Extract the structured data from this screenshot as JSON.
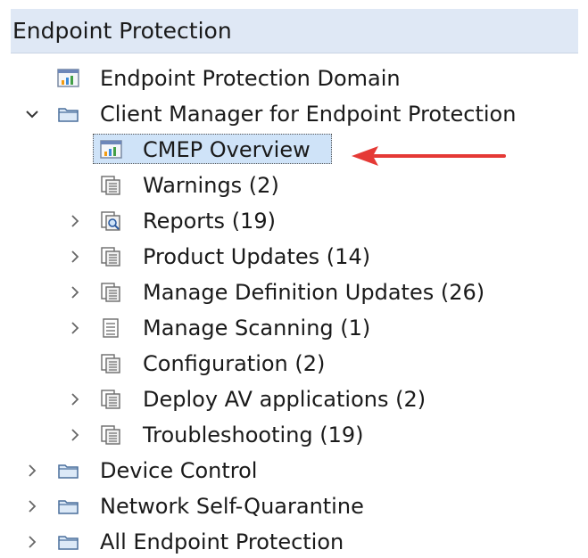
{
  "header": {
    "title": "Endpoint Protection"
  },
  "tree": {
    "items": [
      {
        "label": "Endpoint Protection Domain",
        "icon": "dashboard-icon",
        "expanded": null
      },
      {
        "label": "Client Manager for Endpoint Protection",
        "icon": "folder-icon",
        "expanded": true
      },
      {
        "label": "CMEP Overview",
        "icon": "dashboard-icon",
        "selected": true
      },
      {
        "label": "Warnings (2)",
        "icon": "report-list-icon"
      },
      {
        "label": "Reports (19)",
        "icon": "report-search-icon",
        "expanded": false
      },
      {
        "label": "Product Updates (14)",
        "icon": "report-list-icon",
        "expanded": false
      },
      {
        "label": "Manage Definition Updates (26)",
        "icon": "report-list-icon",
        "expanded": false
      },
      {
        "label": "Manage Scanning (1)",
        "icon": "list-icon",
        "expanded": false
      },
      {
        "label": "Configuration (2)",
        "icon": "report-list-icon"
      },
      {
        "label": "Deploy AV applications (2)",
        "icon": "report-list-icon",
        "expanded": false
      },
      {
        "label": "Troubleshooting (19)",
        "icon": "report-list-icon",
        "expanded": false
      },
      {
        "label": "Device Control",
        "icon": "folder-icon",
        "expanded": false
      },
      {
        "label": "Network Self-Quarantine",
        "icon": "folder-icon",
        "expanded": false
      },
      {
        "label": "All Endpoint Protection",
        "icon": "folder-icon",
        "expanded": false
      }
    ]
  },
  "annotation": {
    "arrow_color": "#e53935"
  }
}
